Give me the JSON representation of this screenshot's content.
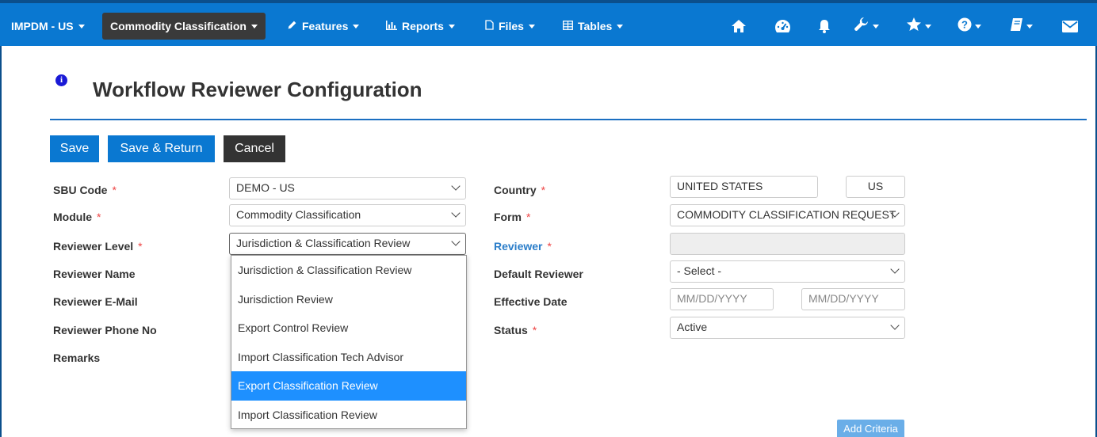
{
  "nav": {
    "app": "IMPDM - US",
    "module": "Commodity Classification",
    "features": "Features",
    "reports": "Reports",
    "files": "Files",
    "tables": "Tables"
  },
  "page": {
    "title": "Workflow Reviewer Configuration"
  },
  "buttons": {
    "save": "Save",
    "save_return": "Save & Return",
    "cancel": "Cancel",
    "add_criteria": "Add Criteria"
  },
  "form": {
    "required_marker": "*",
    "sbu_code": {
      "label": "SBU Code",
      "value": "DEMO - US"
    },
    "module": {
      "label": "Module",
      "value": "Commodity Classification"
    },
    "reviewer_level": {
      "label": "Reviewer Level",
      "value": "Jurisdiction & Classification Review"
    },
    "reviewer_name": {
      "label": "Reviewer Name"
    },
    "reviewer_email": {
      "label": "Reviewer E-Mail"
    },
    "reviewer_phone": {
      "label": "Reviewer Phone No"
    },
    "remarks": {
      "label": "Remarks"
    },
    "country": {
      "label": "Country",
      "value": "UNITED STATES",
      "code": "US"
    },
    "form": {
      "label": "Form",
      "value": "COMMODITY CLASSIFICATION REQUEST"
    },
    "reviewer": {
      "label": "Reviewer",
      "value": ""
    },
    "default_reviewer": {
      "label": "Default Reviewer",
      "value": "- Select -"
    },
    "effective_date": {
      "label": "Effective Date",
      "from_placeholder": "MM/DD/YYYY",
      "to_placeholder": "MM/DD/YYYY"
    },
    "status": {
      "label": "Status",
      "value": "Active"
    }
  },
  "reviewer_level_options": [
    "Jurisdiction & Classification Review",
    "Jurisdiction Review",
    "Export Control Review",
    "Import Classification Tech Advisor",
    "Export Classification Review",
    "Import Classification Review"
  ],
  "highlighted_option_index": 4,
  "colors": {
    "nav_bg": "#0a78d1",
    "active_nav": "#3a3a3a",
    "primary": "#0a78d1",
    "highlight": "#1e90ff"
  }
}
